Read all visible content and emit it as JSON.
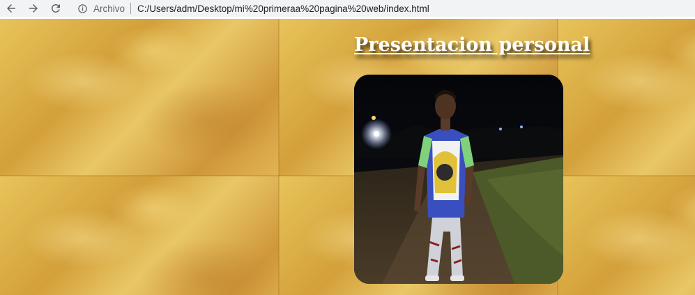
{
  "browser": {
    "scheme_label": "Archivo",
    "url": "C:/Users/adm/Desktop/mi%20primeraa%20pagina%20web/index.html",
    "icons": {
      "back": "arrow-left-icon",
      "forward": "arrow-right-icon",
      "reload": "reload-icon",
      "info": "info-icon"
    }
  },
  "page": {
    "title": "Presentacion personal",
    "photo_description_icon": "person-photo"
  },
  "colors": {
    "background_gold": "#d9a83a",
    "title_text": "#ffffff",
    "chrome_bar": "#f1f3f4"
  }
}
